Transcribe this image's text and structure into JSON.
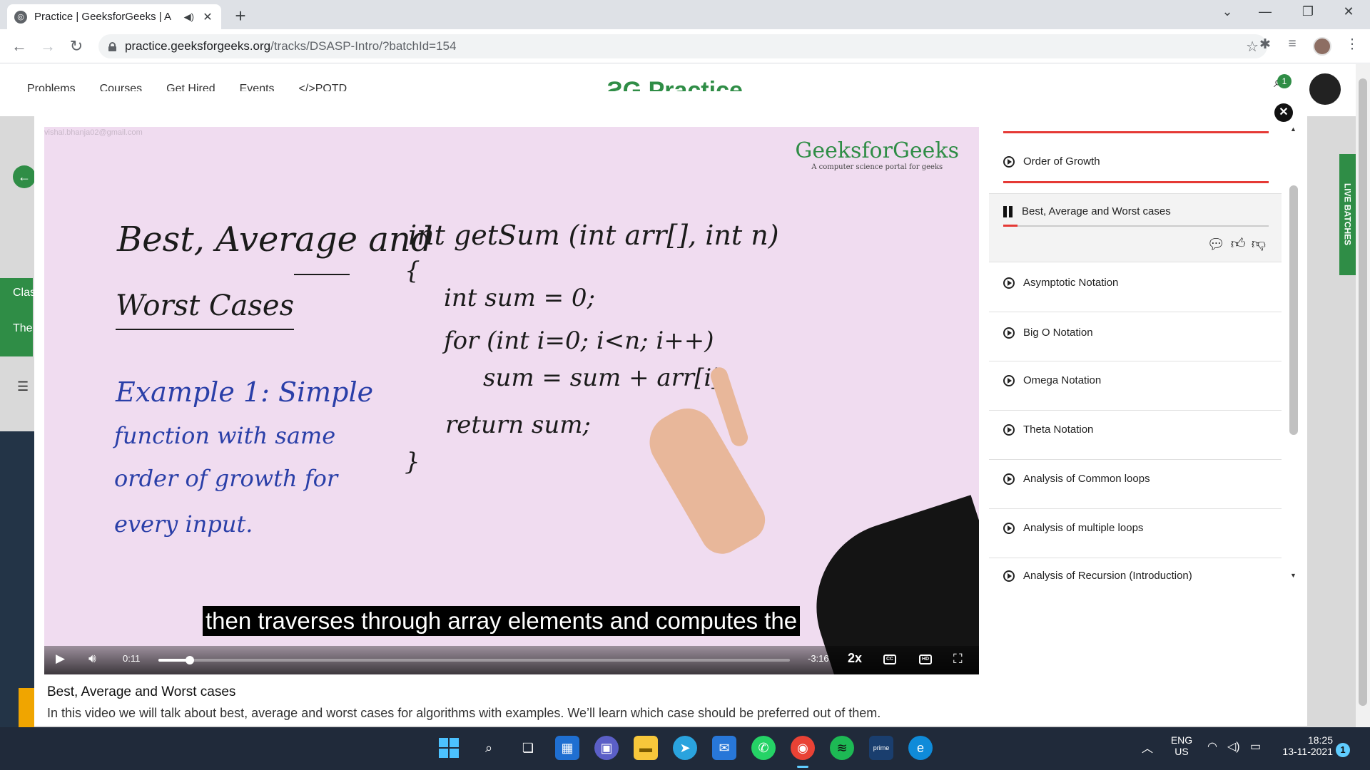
{
  "browser": {
    "tab_title": "Practice | GeeksforGeeks | A",
    "url_host": "practice.geeksforgeeks.org",
    "url_path": "/tracks/DSASP-Intro/?batchId=154"
  },
  "site": {
    "nav": [
      "Problems",
      "Courses",
      "Get Hired",
      "Events",
      "POTD"
    ],
    "logo": "Practice",
    "side_labels": [
      "Clas",
      "The"
    ],
    "live_batches": "LIVE BATCHES",
    "notification_count": "1"
  },
  "video": {
    "watermark": "vishal.bhanja02@gmail.com",
    "brand_name": "GeeksforGeeks",
    "brand_tagline": "A computer science portal for geeks",
    "board": {
      "title_line1": "Best, Average and",
      "title_line2": "Worst Cases",
      "example_lines": [
        "Example 1: Simple",
        "function with same",
        "order of growth for",
        "every input."
      ],
      "code_lines": [
        "int getSum (int arr[], int n)",
        "{",
        "int sum = 0;",
        "for (int i=0; i<n; i++)",
        "sum = sum + arr[i];",
        "return sum;",
        "}"
      ]
    },
    "caption": "then traverses through array elements and computes the",
    "current_time": "0:11",
    "remaining_time": "-3:16",
    "progress": 0.05,
    "speed": "2x",
    "cc_label": "CC",
    "hd_label": "HD",
    "title": "Best, Average and Worst cases",
    "description": "In this video we will talk about best, average and worst cases for algorithms with examples. We’ll learn which case should be preferred out of them."
  },
  "playlist": {
    "items": [
      {
        "label": "Order of Growth",
        "state": "completed"
      },
      {
        "label": "Best, Average and Worst cases",
        "state": "playing"
      },
      {
        "label": "Asymptotic Notation",
        "state": "idle"
      },
      {
        "label": "Big O Notation",
        "state": "idle"
      },
      {
        "label": "Omega Notation",
        "state": "idle"
      },
      {
        "label": "Theta Notation",
        "state": "idle"
      },
      {
        "label": "Analysis of Common loops",
        "state": "idle"
      },
      {
        "label": "Analysis of multiple loops",
        "state": "idle"
      },
      {
        "label": "Analysis of Recursion (Introduction)",
        "state": "idle"
      }
    ]
  },
  "taskbar": {
    "language": "ENG",
    "region": "US",
    "time": "18:25",
    "date": "13-11-2021",
    "notifications": "1"
  },
  "colors": {
    "gfg_green": "#2f8d46",
    "progress_red": "#e53935",
    "taskbar": "#202a3a"
  }
}
